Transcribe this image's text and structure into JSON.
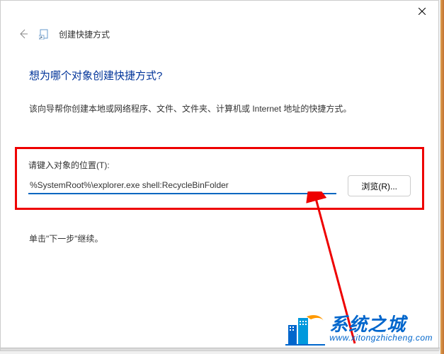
{
  "window": {
    "title": "创建快捷方式"
  },
  "content": {
    "heading": "想为哪个对象创建快捷方式?",
    "description": "该向导帮你创建本地或网络程序、文件、文件夹、计算机或 Internet 地址的快捷方式。",
    "field_label": "请键入对象的位置(T):",
    "path_value": "%SystemRoot%\\explorer.exe shell:RecycleBinFolder",
    "browse_label": "浏览(R)...",
    "footer": "单击\"下一步\"继续。"
  },
  "watermark": {
    "name_cn": "系统之城",
    "url": "www.xitongzhicheng.com"
  }
}
